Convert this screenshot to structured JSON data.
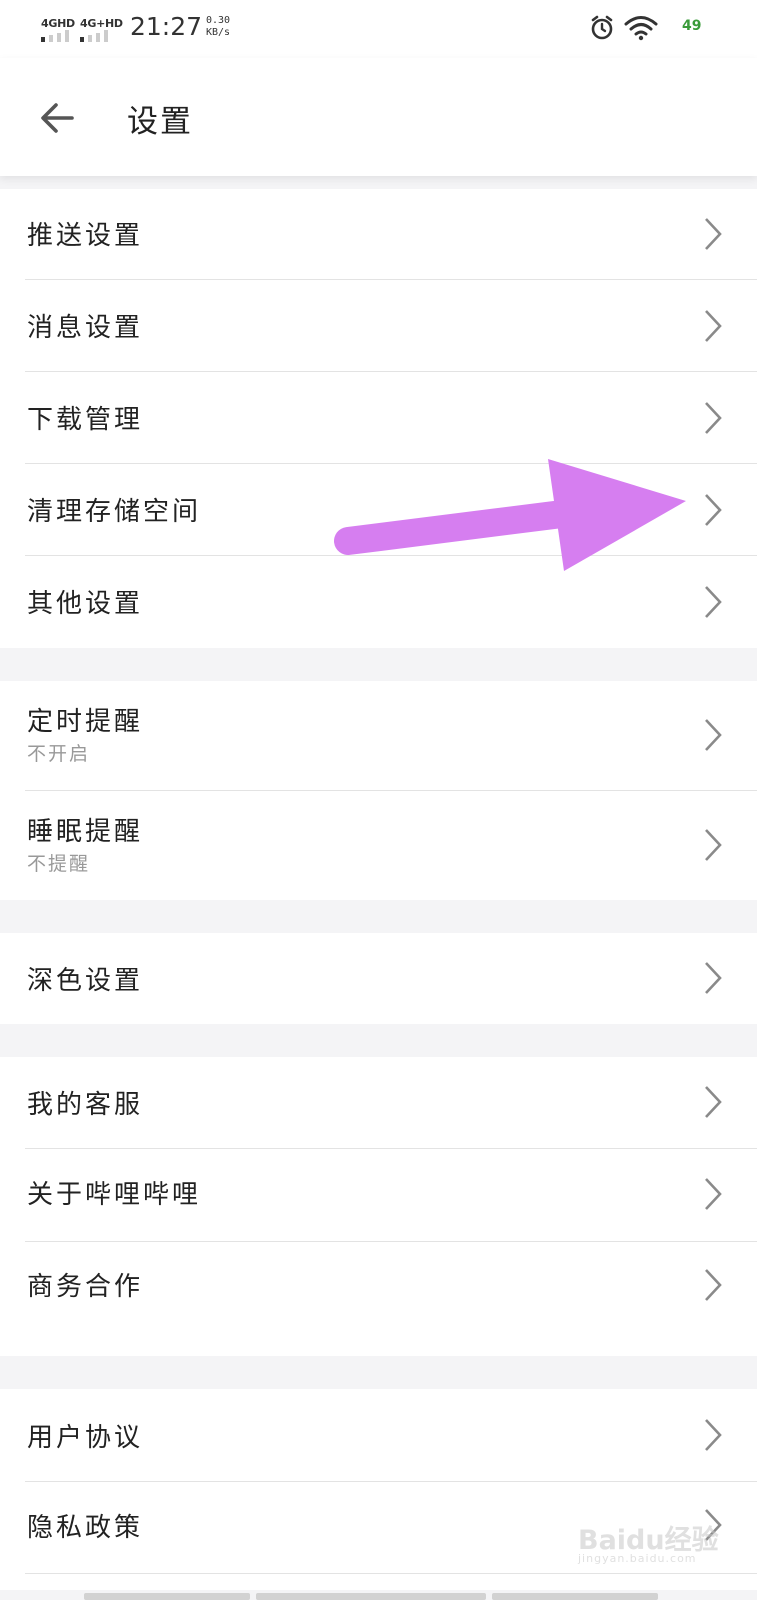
{
  "status_bar": {
    "signal_1": "4GHD",
    "signal_2": "4G+HD",
    "time": "21:27",
    "speed_value": "0.30",
    "speed_unit": "KB/s",
    "battery": "49",
    "icons": [
      "alarm-icon",
      "wifi-icon"
    ]
  },
  "header": {
    "title": "设置",
    "back_icon": "arrow-left-icon"
  },
  "groups": [
    {
      "items": [
        {
          "label": "推送设置"
        },
        {
          "label": "消息设置"
        },
        {
          "label": "下载管理"
        },
        {
          "label": "清理存储空间"
        },
        {
          "label": "其他设置"
        }
      ]
    },
    {
      "items": [
        {
          "label": "定时提醒",
          "sub": "不开启"
        },
        {
          "label": "睡眠提醒",
          "sub": "不提醒"
        }
      ]
    },
    {
      "items": [
        {
          "label": "深色设置"
        }
      ]
    },
    {
      "items": [
        {
          "label": "我的客服"
        },
        {
          "label": "关于哔哩哔哩"
        },
        {
          "label": "商务合作"
        }
      ]
    },
    {
      "items": [
        {
          "label": "用户协议"
        },
        {
          "label": "隐私政策"
        }
      ]
    }
  ],
  "annotation": {
    "color": "#d67ef0",
    "icon": "pointing-arrow-icon"
  },
  "watermark": {
    "text": "Baidu经验",
    "url": "jingyan.baidu.com"
  },
  "colors": {
    "background": "#f4f4f6",
    "card": "#ffffff",
    "divider": "#e3e3e3",
    "chevron": "#8a8a8a",
    "subtext": "#999999"
  }
}
